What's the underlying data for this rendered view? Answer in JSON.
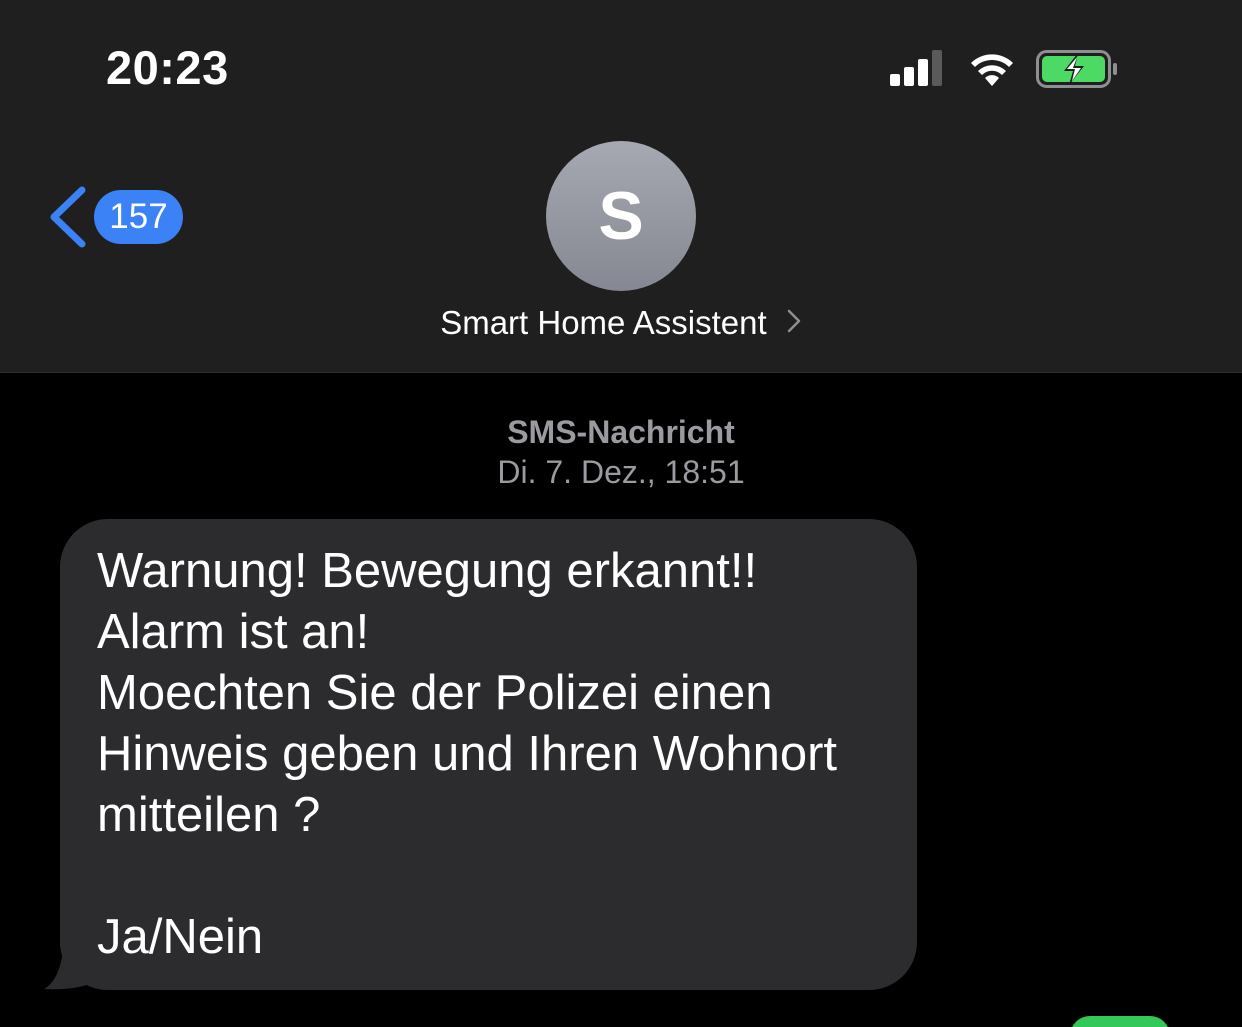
{
  "status_bar": {
    "time": "20:23",
    "icons": [
      "signal-icon",
      "wifi-icon",
      "battery-charging-icon"
    ],
    "battery_color": "#4cd964"
  },
  "nav": {
    "back_badge": "157",
    "avatar_initial": "S",
    "contact_name": "Smart Home Assistent"
  },
  "conversation": {
    "message_type": "SMS-Nachricht",
    "timestamp": "Di. 7. Dez., 18:51",
    "messages": [
      {
        "direction": "incoming",
        "text": "Warnung! Bewegung erkannt!!\nAlarm ist an!\nMoechten Sie der Polizei einen Hinweis geben und Ihren Wohnort mitteilen ?\n\nJa/Nein"
      }
    ]
  },
  "colors": {
    "header_bg": "#1f1f1f",
    "bubble_incoming": "#2c2c2e",
    "accent": "#3a82f6",
    "outgoing": "#34c759"
  }
}
